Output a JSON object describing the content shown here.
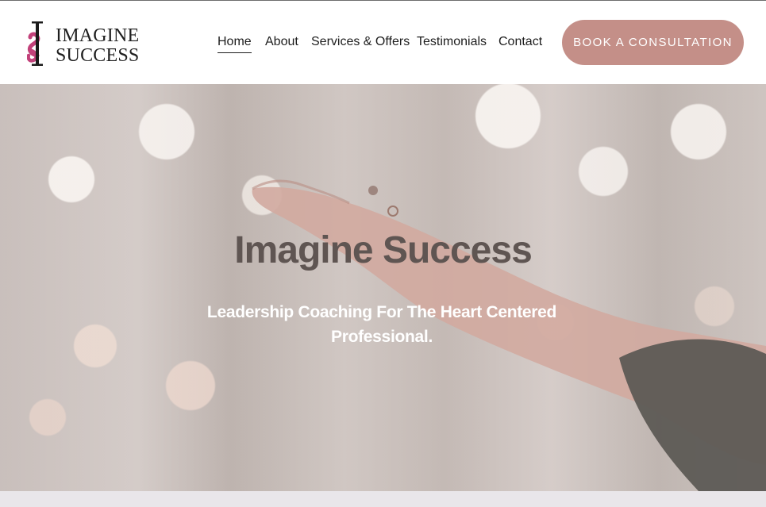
{
  "brand": {
    "logo_letters": "IS",
    "name_line1": "IMAGINE",
    "name_line2": "SUCCESS",
    "accent_color": "#c2417a"
  },
  "nav": {
    "items": [
      {
        "label": "Home",
        "active": true
      },
      {
        "label": "About",
        "active": false
      },
      {
        "label": "Services & Offers",
        "active": false
      },
      {
        "label": "Testimonials",
        "active": false
      },
      {
        "label": "Contact",
        "active": false
      }
    ]
  },
  "cta": {
    "label": "BOOK A CONSULTATION",
    "color": "#c48f88"
  },
  "hero": {
    "title": "Imagine Success",
    "subtitle": "Leadership Coaching For The Heart Centered Professional."
  }
}
